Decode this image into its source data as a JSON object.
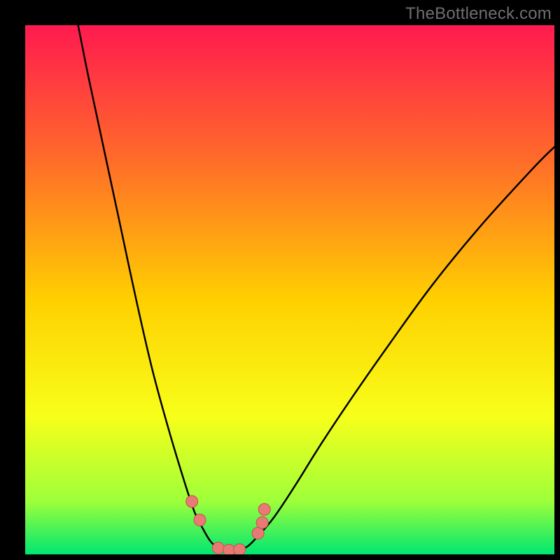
{
  "watermark": "TheBottleneck.com",
  "colors": {
    "frame": "#000000",
    "gradient_top": "#ff1a4f",
    "gradient_upper_mid": "#ff6a2a",
    "gradient_mid": "#ffd000",
    "gradient_lower_mid": "#f7ff1a",
    "gradient_near_bottom": "#9dff3a",
    "gradient_bottom": "#00e672",
    "curve": "#000000",
    "marker_fill": "#e77a74",
    "marker_stroke": "#c94f4a"
  },
  "chart_data": {
    "type": "line",
    "title": "",
    "xlabel": "",
    "ylabel": "",
    "xlim": [
      0,
      100
    ],
    "ylim": [
      0,
      100
    ],
    "curve": {
      "name": "bottleneck-curve",
      "x": [
        10,
        12,
        15,
        18,
        21,
        24,
        27,
        30,
        32,
        33.5,
        35,
        36.5,
        38,
        40,
        42,
        44,
        47,
        51,
        56,
        62,
        69,
        77,
        86,
        96,
        100
      ],
      "y": [
        100,
        90,
        76,
        62,
        48,
        35,
        24,
        14,
        8,
        5,
        2.5,
        1.2,
        0.6,
        0.7,
        1.5,
        3.5,
        7,
        13,
        21,
        30,
        40,
        51,
        62,
        73,
        77
      ]
    },
    "markers": {
      "name": "points",
      "x": [
        31.5,
        33,
        36.5,
        38.5,
        40.5,
        44,
        44.8,
        45.2
      ],
      "y": [
        10,
        6.5,
        1.2,
        0.8,
        0.9,
        4,
        6,
        8.5
      ]
    }
  }
}
